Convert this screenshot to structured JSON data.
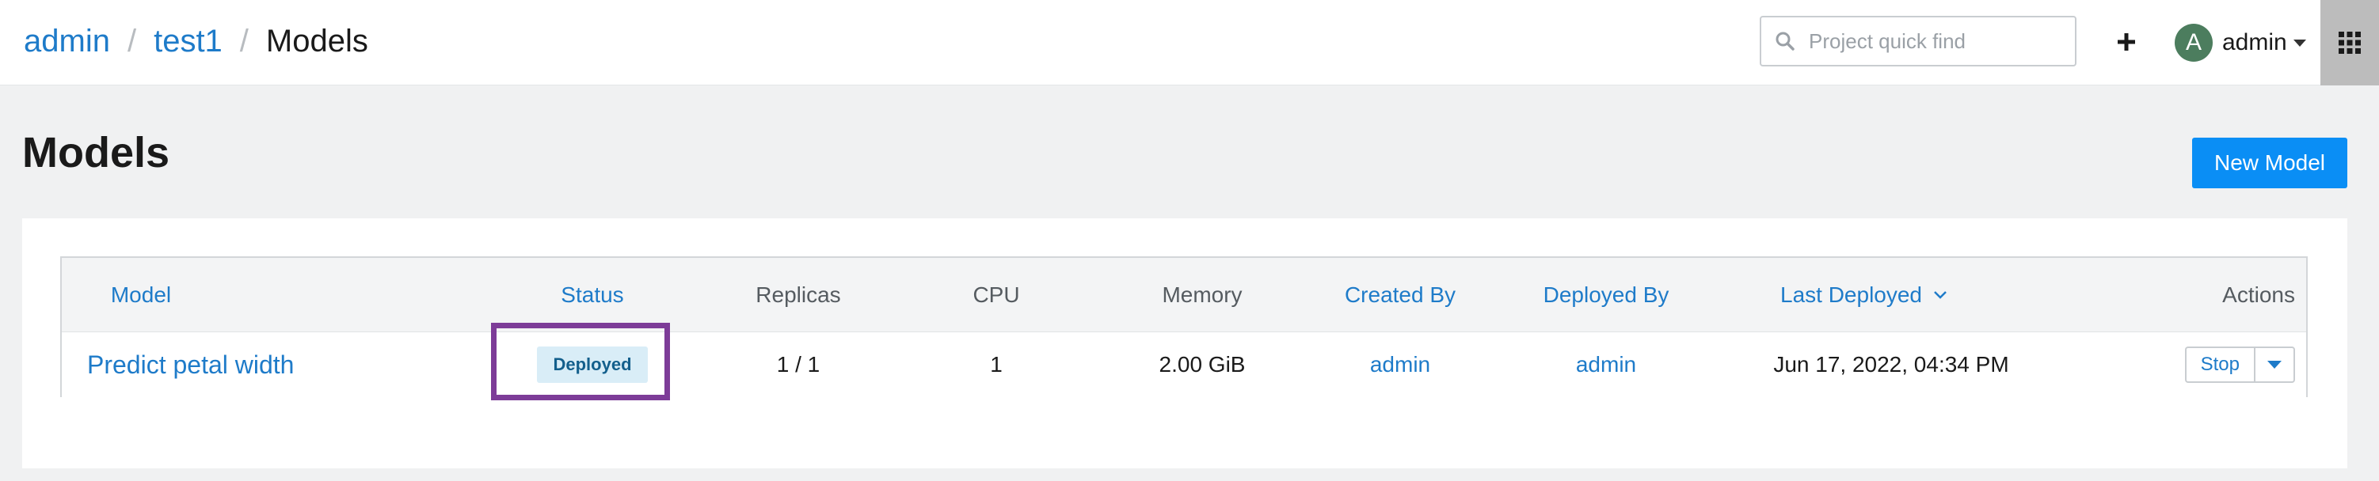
{
  "breadcrumb": {
    "items": [
      "admin",
      "test1"
    ],
    "current": "Models",
    "separator": "/"
  },
  "search": {
    "placeholder": "Project quick find",
    "value": ""
  },
  "user": {
    "initial": "A",
    "name": "admin"
  },
  "page": {
    "title": "Models"
  },
  "toolbar": {
    "new_model_label": "New Model"
  },
  "table": {
    "columns": [
      "Model",
      "Status",
      "Replicas",
      "CPU",
      "Memory",
      "Created By",
      "Deployed By",
      "Last Deployed",
      "Actions"
    ],
    "rows": [
      {
        "model": "Predict petal width",
        "status": "Deployed",
        "replicas": "1 / 1",
        "cpu": "1",
        "memory": "2.00 GiB",
        "created_by": "admin",
        "deployed_by": "admin",
        "last_deployed": "Jun 17, 2022, 04:34 PM",
        "action_label": "Stop"
      }
    ]
  },
  "colors": {
    "link": "#1e7bc9",
    "primary_button": "#0a8ef5",
    "status_badge_bg": "#d9edf7",
    "highlight_frame": "#7d3c98",
    "avatar_bg": "#4c7d5e"
  },
  "icons": [
    "search-icon",
    "plus-icon",
    "chevron-down-icon",
    "apps-grid-icon",
    "caret-down-icon"
  ]
}
